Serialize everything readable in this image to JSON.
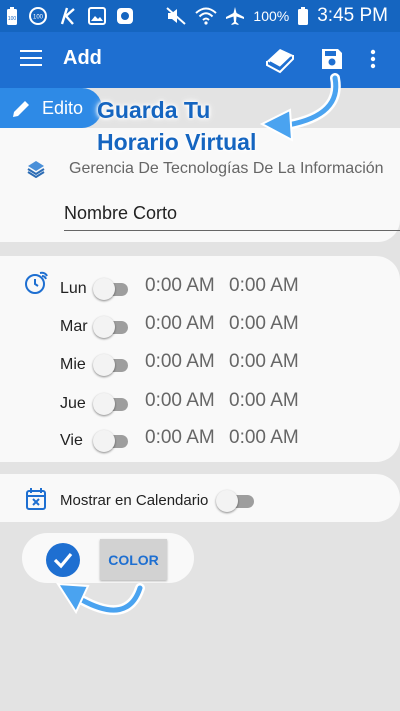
{
  "status_bar": {
    "battery_text": "100%",
    "time": "3:45 PM",
    "badge_1": "100",
    "badge_2": "100"
  },
  "app_bar": {
    "title": "Add"
  },
  "editor_tab": {
    "label": "Edito"
  },
  "department": {
    "value": "Gerencia De Tecnologías De La Información"
  },
  "short_name": {
    "value": "Nombre Corto"
  },
  "schedule": [
    {
      "day": "Lun",
      "start": "0:00 AM",
      "end": "0:00 AM"
    },
    {
      "day": "Mar",
      "start": "0:00 AM",
      "end": "0:00 AM"
    },
    {
      "day": "Mie",
      "start": "0:00 AM",
      "end": "0:00 AM"
    },
    {
      "day": "Jue",
      "start": "0:00 AM",
      "end": "0:00 AM"
    },
    {
      "day": "Vie",
      "start": "0:00 AM",
      "end": "0:00 AM"
    }
  ],
  "calendar": {
    "label": "Mostrar en Calendario"
  },
  "color_button": {
    "label": "COLOR"
  },
  "callout": {
    "line1": "Guarda Tu",
    "line2": "Horario Virtual"
  },
  "colors": {
    "primary": "#1e6fd1",
    "status_bar": "#1565c0",
    "callout_text": "#1565c0",
    "tab": "#2e8ae6"
  }
}
